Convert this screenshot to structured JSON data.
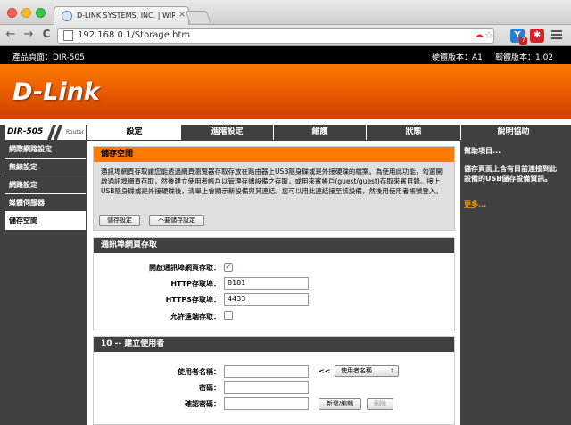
{
  "browser": {
    "tab_title": "D-LINK SYSTEMS, INC. | WIRE",
    "tab_close": "×",
    "back": "←",
    "forward": "→",
    "reload": "C",
    "url": "192.168.0.1/Storage.htm",
    "ext1": "7",
    "ext_icon2": "✱"
  },
  "header": {
    "product": "產品頁面：DIR-505",
    "hw": "硬體版本：A1",
    "fw": "韌體版本：1.02",
    "logo": "D-Link",
    "model": "DIR-505",
    "router": "Router"
  },
  "tabs": [
    "設定",
    "進階設定",
    "維護",
    "狀態",
    "說明協助"
  ],
  "sidebar": [
    "網際網路設定",
    "無線設定",
    "網路設定",
    "媒體伺服器",
    "儲存空間"
  ],
  "storage": {
    "title": "儲存空間",
    "desc": "通訊埠網頁存取讓您能透過網頁瀏覽器存取存放在路由器上USB隨身碟或是外接硬碟的檔案。為使用此功能，勾選開啟通訊埠網頁存取，然後建立使用者帳戶以管理存儲設備之存取，或用來賓帳戶(guest/guest)存取來賓目錄。接上USB隨身碟或是外接硬碟後，清單上會顯示新設備與其連結。您可以用此連結接至該設備，然後用使用者帳號登入。",
    "save": "儲存設定",
    "nosave": "不要儲存設定"
  },
  "webaccess": {
    "title": "通訊埠網頁存取",
    "enable_label": "開啟通訊埠網頁存取：",
    "enable_check": "✓",
    "http_label": "HTTP存取埠：",
    "http_value": "8181",
    "https_label": "HTTPS存取埠：",
    "https_value": "4433",
    "remote_label": "允許遠端存取："
  },
  "users": {
    "title": "10 -- 建立使用者",
    "username_label": "使用者名稱：",
    "arrows": "<<",
    "select_value": "使用者名稱",
    "password_label": "密碼：",
    "confirm_label": "確認密碼：",
    "add_edit": "新增/編輯",
    "delete": "刪除"
  },
  "help": {
    "title": "幫助項目...",
    "text": "儲存頁面上含有目前連接到此設備的USB儲存設備資訊。",
    "more": "更多..."
  },
  "colors": {
    "accent": "#ff7a00",
    "dark": "#404040",
    "link": "#ff9a00"
  }
}
